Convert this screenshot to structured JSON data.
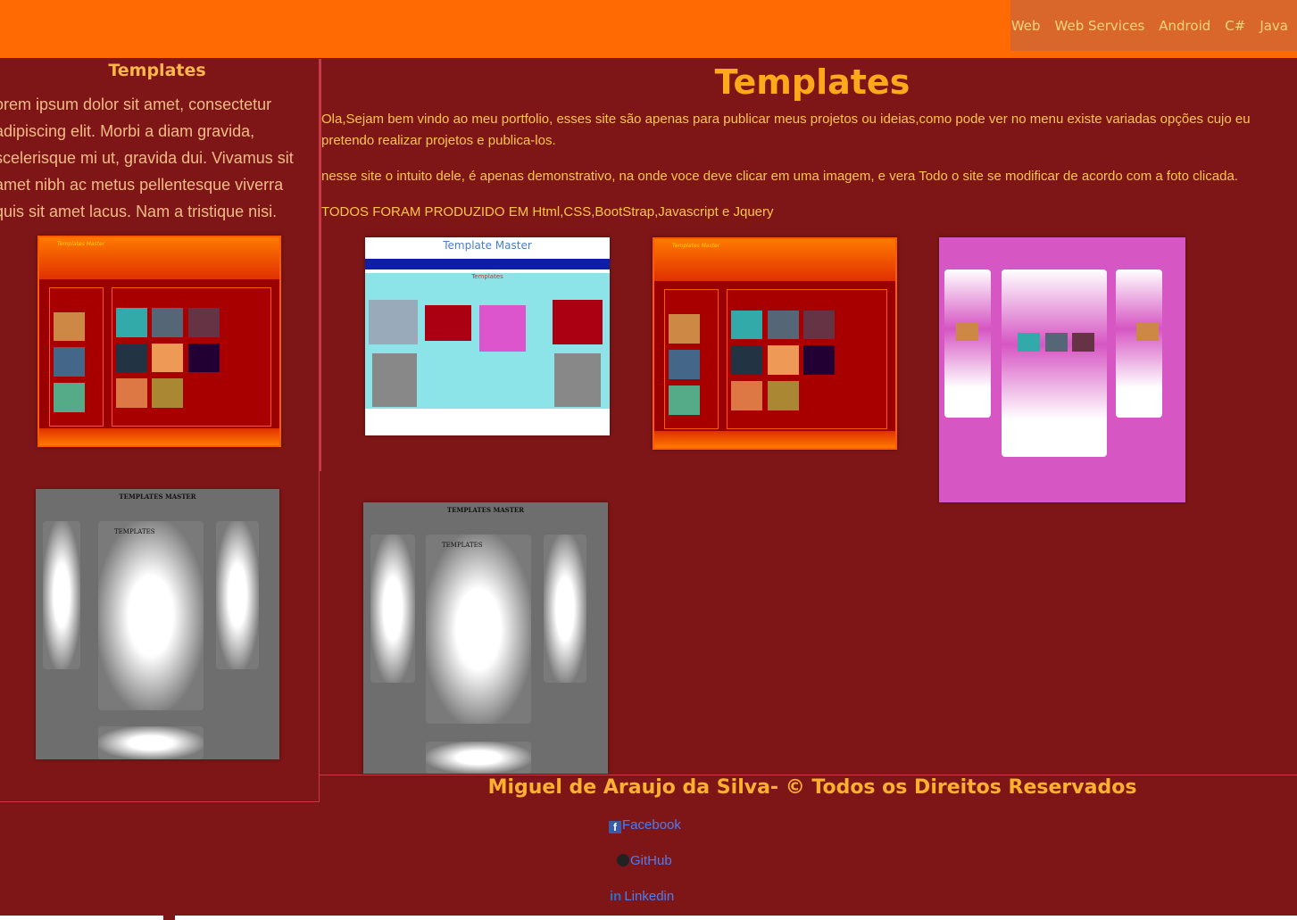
{
  "nav": {
    "items": [
      "Web",
      "Web Services",
      "Android",
      "C#",
      "Java"
    ]
  },
  "sidebar": {
    "title": "Templates",
    "text": "orem ipsum dolor sit amet, consectetur adipiscing elit. Morbi a diam gravida, scelerisque mi ut, gravida dui. Vivamus sit amet nibh ac metus pellentesque viverra quis sit amet lacus. Nam a tristique nisi."
  },
  "main": {
    "title": "Templates",
    "para1": "Ola,Sejam bem vindo ao meu portfolio, esses site são apenas para publicar meus projetos ou ideias,como pode ver no menu existe variadas opções cujo eu pretendo realizar projetos e publica-los.",
    "para2": "nesse site o intuito dele, é apenas demonstrativo, na onde voce deve clicar em uma imagem, e vera Todo o site se modificar de acordo com a foto clicada.",
    "para3": "TODOS FORAM PRODUZIDO EM Html,CSS,BootStrap,Javascript e Jquery"
  },
  "thumbs": {
    "red_title": "Templates Master",
    "white_title": "Template Master",
    "white_heading": "Templates",
    "gray_title": "TEMPLATES MASTER",
    "gray_heading": "TEMPLATES"
  },
  "footer": {
    "title": "Miguel de Araujo da Silva- © Todos os Direitos Reservados",
    "facebook": "Facebook",
    "github": "GitHub",
    "linkedin": "Linkedin"
  },
  "colors": {
    "header": "#ff6a02",
    "background": "#7e1617",
    "accent": "#ffa91a",
    "link": "#4c7df0"
  }
}
